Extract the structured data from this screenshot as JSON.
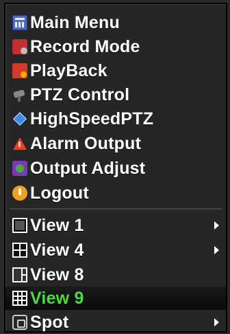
{
  "menu": {
    "items": [
      {
        "label": "Main Menu",
        "icon": "main-menu-icon",
        "submenu": false
      },
      {
        "label": "Record Mode",
        "icon": "record-mode-icon",
        "submenu": false
      },
      {
        "label": "PlayBack",
        "icon": "playback-icon",
        "submenu": false
      },
      {
        "label": "PTZ Control",
        "icon": "ptz-camera-icon",
        "submenu": false
      },
      {
        "label": "HighSpeedPTZ",
        "icon": "high-speed-ptz-icon",
        "submenu": false
      },
      {
        "label": "Alarm Output",
        "icon": "alarm-icon",
        "submenu": false
      },
      {
        "label": "Output Adjust",
        "icon": "output-adjust-icon",
        "submenu": false
      },
      {
        "label": "Logout",
        "icon": "logout-icon",
        "submenu": false
      }
    ],
    "views": [
      {
        "label": "View 1",
        "icon": "single-view-icon",
        "submenu": true
      },
      {
        "label": "View 4",
        "icon": "quad-view-icon",
        "submenu": true
      },
      {
        "label": "View 8",
        "icon": "eight-view-icon",
        "submenu": false
      },
      {
        "label": "View 9",
        "icon": "nine-view-icon",
        "submenu": false,
        "selected": true
      },
      {
        "label": "Spot",
        "icon": "spot-icon",
        "submenu": true
      }
    ],
    "colors": {
      "selected_text": "#4cdc3c",
      "text": "#ffffff",
      "background": "#262626"
    }
  }
}
